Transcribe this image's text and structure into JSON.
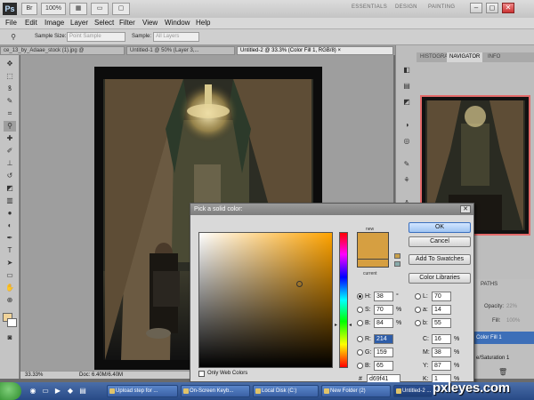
{
  "app": {
    "logo": "Ps",
    "bar_buttons": [
      "Br",
      "100%"
    ],
    "workspaces": [
      "ESSENTIALS",
      "DESIGN",
      "PAINTING"
    ],
    "window_controls": [
      "–",
      "◻",
      "✕"
    ]
  },
  "menu": [
    "File",
    "Edit",
    "Image",
    "Layer",
    "Select",
    "Filter",
    "View",
    "Window",
    "Help"
  ],
  "options_bar": {
    "sample_size_label": "Sample Size:",
    "sample_size_value": "Point Sample",
    "sample_label": "Sample:",
    "sample_value": "All Layers"
  },
  "document_tabs": [
    "ce_13_by_Adaae_stock (1).jpg @",
    "Untitled-1 @ 50% (Layer 3,...",
    "Untitled-2 @ 33.3% (Color Fill 1, RGB/8) ×"
  ],
  "status_bar": {
    "zoom": "33.33%",
    "doc": "Doc: 6.40M/6.40M"
  },
  "panels": {
    "tabs": [
      "HISTOGRA",
      "NAVIGATOR",
      "INFO"
    ],
    "layers_tab": "PATHS",
    "opacity_label": "Opacity:",
    "opacity_value": "22%",
    "fill_label": "Fill:",
    "fill_value": "100%",
    "layers": [
      "Color Fill 1",
      "e/Saturation 1"
    ]
  },
  "color_picker": {
    "title": "Pick a solid color:",
    "new_label": "new",
    "current_label": "current",
    "new_color": "#d69f41",
    "current_color": "#d69f41",
    "buttons": {
      "ok": "OK",
      "cancel": "Cancel",
      "add_to_swatches": "Add To Swatches",
      "color_libraries": "Color Libraries"
    },
    "hsb": [
      {
        "label": "H:",
        "value": "38",
        "unit": "°",
        "selected": true
      },
      {
        "label": "S:",
        "value": "70",
        "unit": "%"
      },
      {
        "label": "B:",
        "value": "84",
        "unit": "%"
      }
    ],
    "rgb": [
      {
        "label": "R:",
        "value": "214"
      },
      {
        "label": "G:",
        "value": "159"
      },
      {
        "label": "B:",
        "value": "65"
      }
    ],
    "lab": [
      {
        "label": "L:",
        "value": "70"
      },
      {
        "label": "a:",
        "value": "14"
      },
      {
        "label": "b:",
        "value": "55"
      }
    ],
    "cmyk": [
      {
        "label": "C:",
        "value": "16",
        "unit": "%"
      },
      {
        "label": "M:",
        "value": "38",
        "unit": "%"
      },
      {
        "label": "Y:",
        "value": "87",
        "unit": "%"
      },
      {
        "label": "K:",
        "value": "1",
        "unit": "%"
      }
    ],
    "only_web_colors": "Only Web Colors",
    "hex_sign": "#",
    "hex": "d69f41"
  },
  "taskbar": {
    "items": [
      "Upload step for ...",
      "On-Screen Keyb...",
      "Local Disk (C:)",
      "New Folder (2)",
      "Untitled-2 ..."
    ]
  },
  "watermark": "pxleyes.com"
}
